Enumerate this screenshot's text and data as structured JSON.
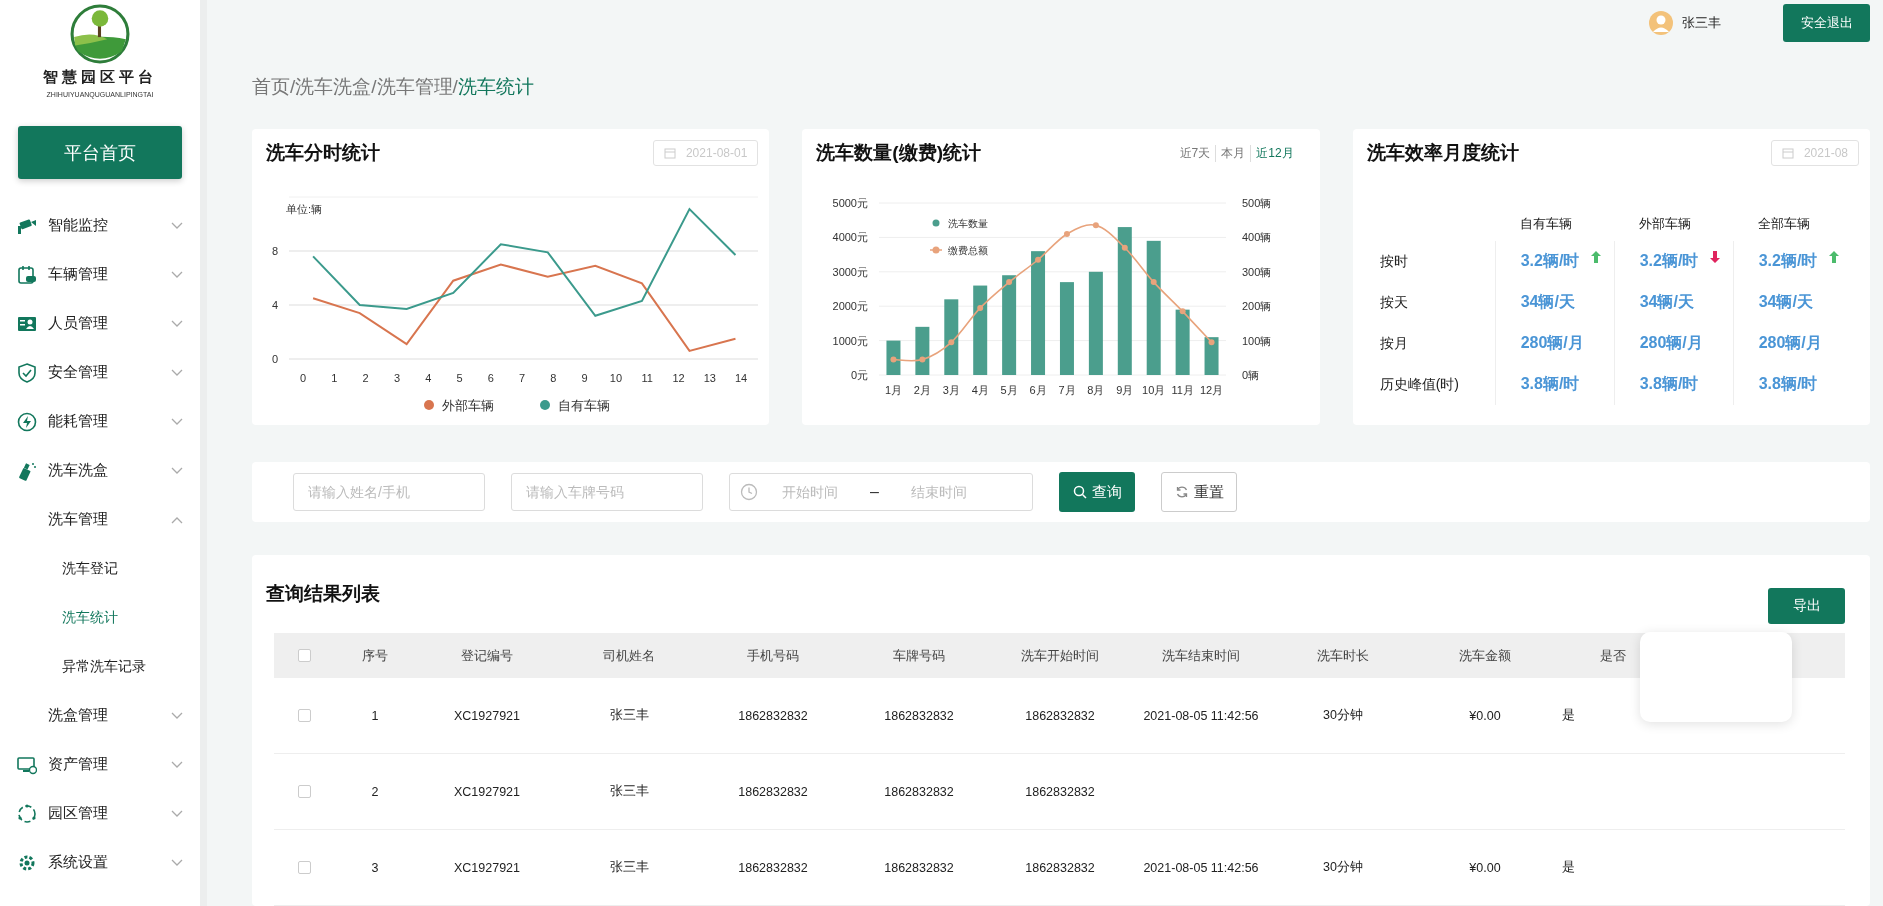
{
  "sidebar": {
    "logo_title": "智慧园区平台",
    "logo_subtitle": "ZHIHUIYUANQUGUANLIPINGTAI",
    "home_button": "平台首页",
    "menu": [
      {
        "label": "智能监控",
        "expanded": false
      },
      {
        "label": "车辆管理",
        "expanded": false
      },
      {
        "label": "人员管理",
        "expanded": false
      },
      {
        "label": "安全管理",
        "expanded": false
      },
      {
        "label": "能耗管理",
        "expanded": false
      },
      {
        "label": "洗车洗盒",
        "expanded": false,
        "children": [
          {
            "label": "洗车管理",
            "expanded": true,
            "children": [
              {
                "label": "洗车登记",
                "selected": false
              },
              {
                "label": "洗车统计",
                "selected": true
              },
              {
                "label": "异常洗车记录",
                "selected": false
              }
            ]
          },
          {
            "label": "洗盒管理",
            "expanded": false
          }
        ]
      },
      {
        "label": "资产管理",
        "expanded": false
      },
      {
        "label": "园区管理",
        "expanded": false
      },
      {
        "label": "系统设置",
        "expanded": false
      }
    ]
  },
  "header": {
    "user_name": "张三丰",
    "logout_button": "安全退出"
  },
  "breadcrumb": {
    "separator": "/",
    "items": [
      {
        "label": "首页",
        "selected": false
      },
      {
        "label": "洗车洗盒",
        "selected": false
      },
      {
        "label": "洗车管理",
        "selected": false
      },
      {
        "label": "洗车统计",
        "selected": true
      }
    ]
  },
  "hourly": {
    "title": "洗车分时统计",
    "date": "2021-08-01",
    "chart_data": {
      "type": "line",
      "ylabel": "单位:辆",
      "legend": true,
      "grid": true,
      "x": [
        0.32,
        1.81,
        3.31,
        4.8,
        6.32,
        7.82,
        9.34,
        10.83,
        12.35,
        13.82
      ],
      "xlim": [
        -0.45,
        14.54
      ],
      "ylim": [
        0,
        12
      ],
      "xticks": [
        0,
        1,
        2,
        3,
        4,
        5,
        6,
        7,
        8,
        9,
        10,
        11,
        12,
        13,
        14
      ],
      "yticks": [
        0,
        4,
        8
      ],
      "series": [
        {
          "name": "外部车辆",
          "color": "#d8754f",
          "values": [
            4.5,
            3.4,
            1.1,
            5.8,
            7.0,
            6.1,
            6.9,
            5.6,
            0.6,
            1.5
          ]
        },
        {
          "name": "自有车辆",
          "color": "#3b9a8c",
          "values": [
            7.6,
            4.0,
            3.7,
            4.9,
            8.5,
            7.9,
            3.2,
            4.3,
            11.1,
            7.7
          ]
        }
      ]
    }
  },
  "count": {
    "title": "洗车数量(缴费)统计",
    "ranges": [
      {
        "label": "近7天",
        "selected": false
      },
      {
        "label": "本月",
        "selected": false
      },
      {
        "label": "近12月",
        "selected": true
      }
    ],
    "chart_data": {
      "type": "bar",
      "legend": true,
      "grid": true,
      "categories": [
        "1月",
        "2月",
        "3月",
        "4月",
        "5月",
        "6月",
        "7月",
        "8月",
        "9月",
        "10月",
        "11月",
        "12月"
      ],
      "ylim": [
        0,
        5000
      ],
      "yticks": [
        {
          "value": 0,
          "label": "0元"
        },
        {
          "value": 1000,
          "label": "1000元"
        },
        {
          "value": 2000,
          "label": "2000元"
        },
        {
          "value": 3000,
          "label": "3000元"
        },
        {
          "value": 4000,
          "label": "4000元"
        },
        {
          "value": 5000,
          "label": "5000元"
        }
      ],
      "y2lim": [
        0,
        500
      ],
      "y2ticks": [
        {
          "value": 0,
          "label": "0辆"
        },
        {
          "value": 100,
          "label": "100辆"
        },
        {
          "value": 200,
          "label": "200辆"
        },
        {
          "value": 300,
          "label": "300辆"
        },
        {
          "value": 400,
          "label": "400辆"
        },
        {
          "value": 500,
          "label": "500辆"
        }
      ],
      "series": [
        {
          "name": "洗车数量",
          "type": "bar",
          "axis": "y2",
          "color": "#4b9e8d",
          "values": [
            100,
            140,
            220,
            260,
            290,
            360,
            270,
            300,
            430,
            390,
            190,
            110
          ]
        },
        {
          "name": "缴费总额",
          "type": "line",
          "marker": true,
          "color": "#e8a37c",
          "values": [
            450,
            450,
            950,
            1950,
            2700,
            3350,
            4100,
            4350,
            3700,
            2700,
            1850,
            950
          ]
        }
      ]
    }
  },
  "efficiency": {
    "title": "洗车效率月度统计",
    "date": "2021-08",
    "columns": [
      {
        "kind": "stub"
      },
      {
        "kind": "text",
        "label": "自有车辆"
      },
      {
        "kind": "text",
        "label": "外部车辆"
      },
      {
        "kind": "text",
        "label": "全部车辆"
      }
    ],
    "rows": [
      {
        "cells": [
          {
            "kind": "label",
            "text": "按时"
          },
          {
            "kind": "value",
            "text": "3.2辆/时",
            "rising": true
          },
          {
            "kind": "value",
            "text": "3.2辆/时",
            "rising": false
          },
          {
            "kind": "value",
            "text": "3.2辆/时",
            "rising": true
          }
        ]
      },
      {
        "cells": [
          {
            "kind": "label",
            "text": "按天"
          },
          {
            "kind": "value",
            "text": "34辆/天"
          },
          {
            "kind": "value",
            "text": "34辆/天"
          },
          {
            "kind": "value",
            "text": "34辆/天"
          }
        ]
      },
      {
        "cells": [
          {
            "kind": "label",
            "text": "按月"
          },
          {
            "kind": "value",
            "text": "280辆/月"
          },
          {
            "kind": "value",
            "text": "280辆/月"
          },
          {
            "kind": "value",
            "text": "280辆/月"
          }
        ]
      },
      {
        "cells": [
          {
            "kind": "label",
            "text": "历史峰值(时)"
          },
          {
            "kind": "value",
            "text": "3.8辆/时"
          },
          {
            "kind": "value",
            "text": "3.8辆/时"
          },
          {
            "kind": "value",
            "text": "3.8辆/时"
          }
        ]
      }
    ]
  },
  "search": {
    "fields": [
      {
        "placeholder": "请输入姓名/手机"
      },
      {
        "placeholder": "请输入车牌号码"
      }
    ],
    "date_range": {
      "start_placeholder": "开始时间",
      "separator": "–",
      "end_placeholder": "结束时间"
    },
    "buttons": [
      {
        "label": "查询",
        "kind": "primary"
      },
      {
        "label": "重置",
        "kind": "default"
      }
    ]
  },
  "results": {
    "title": "查询结果列表",
    "export_button": "导出",
    "columns": [
      {
        "kind": "checkbox",
        "checked": false
      },
      {
        "kind": "text",
        "label": "序号"
      },
      {
        "kind": "text",
        "label": "登记编号"
      },
      {
        "kind": "text",
        "label": "司机姓名"
      },
      {
        "kind": "text",
        "label": "手机号码"
      },
      {
        "kind": "text",
        "label": "车牌号码"
      },
      {
        "kind": "text",
        "label": "洗车开始时间"
      },
      {
        "kind": "text",
        "label": "洗车结束时间"
      },
      {
        "kind": "text",
        "label": "洗车时长"
      },
      {
        "kind": "text",
        "label": "洗车金额"
      },
      {
        "kind": "text",
        "label": "是否"
      }
    ],
    "rows": [
      {
        "cells": [
          {
            "kind": "checkbox",
            "checked": false
          },
          {
            "kind": "text",
            "text": "1"
          },
          {
            "kind": "text",
            "text": "XC1927921"
          },
          {
            "kind": "text",
            "text": "张三丰"
          },
          {
            "kind": "text",
            "text": "1862832832"
          },
          {
            "kind": "text",
            "text": "1862832832"
          },
          {
            "kind": "text",
            "text": "1862832832"
          },
          {
            "kind": "text",
            "text": "2021-08-05 11:42:56"
          },
          {
            "kind": "text",
            "text": "30分钟"
          },
          {
            "kind": "text",
            "text": "¥0.00"
          },
          {
            "kind": "text",
            "text": "是"
          }
        ]
      },
      {
        "cells": [
          {
            "kind": "checkbox",
            "checked": false
          },
          {
            "kind": "text",
            "text": "2"
          },
          {
            "kind": "text",
            "text": "XC1927921"
          },
          {
            "kind": "text",
            "text": "张三丰"
          },
          {
            "kind": "text",
            "text": "1862832832"
          },
          {
            "kind": "text",
            "text": "1862832832"
          },
          {
            "kind": "text",
            "text": "1862832832"
          }
        ]
      },
      {
        "cells": [
          {
            "kind": "checkbox",
            "checked": false
          },
          {
            "kind": "text",
            "text": "3"
          },
          {
            "kind": "text",
            "text": "XC1927921"
          },
          {
            "kind": "text",
            "text": "张三丰"
          },
          {
            "kind": "text",
            "text": "1862832832"
          },
          {
            "kind": "text",
            "text": "1862832832"
          },
          {
            "kind": "text",
            "text": "1862832832"
          },
          {
            "kind": "text",
            "text": "2021-08-05 11:42:56"
          },
          {
            "kind": "text",
            "text": "30分钟"
          },
          {
            "kind": "text",
            "text": "¥0.00"
          },
          {
            "kind": "text",
            "text": "是"
          }
        ]
      }
    ]
  }
}
